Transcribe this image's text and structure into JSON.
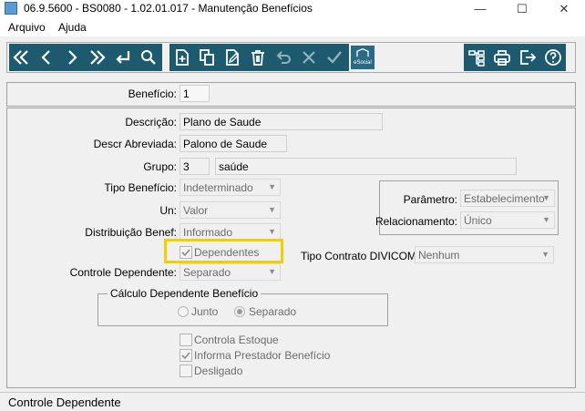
{
  "window": {
    "title": "06.9.5600 - BS0080 - 1.02.01.017 - Manutenção Benefícios",
    "minimize": "—",
    "maximize": "☐",
    "close": "✕"
  },
  "menu": [
    "Arquivo",
    "Ajuda"
  ],
  "toolbar": {
    "esocial_label": "eSocial",
    "accent": "#1e5a6e"
  },
  "form": {
    "beneficio_label": "Benefício:",
    "beneficio_value": "1",
    "descricao_label": "Descrição:",
    "descricao_value": "Plano de Saude",
    "descr_abrev_label": "Descr Abreviada:",
    "descr_abrev_value": "Palono de Saude",
    "grupo_label": "Grupo:",
    "grupo_code": "3",
    "grupo_name": "saúde",
    "tipo_beneficio_label": "Tipo Benefício:",
    "tipo_beneficio_value": "Indeterminado",
    "un_label": "Un:",
    "un_value": "Valor",
    "distribuicao_label": "Distribuição Benef:",
    "distribuicao_value": "Informado",
    "dependentes_label": "Dependentes",
    "controle_dependente_label": "Controle Dependente:",
    "controle_dependente_value": "Separado",
    "parametro_label": "Parâmetro:",
    "parametro_value": "Estabelecimento",
    "relacionamento_label": "Relacionamento:",
    "relacionamento_value": "Único",
    "tipo_contrato_label": "Tipo Contrato DIVICOM:",
    "tipo_contrato_value": "Nenhum",
    "calculo_group_label": "Cálculo Dependente Benefício",
    "radio_junto": "Junto",
    "radio_separado": "Separado",
    "controla_estoque": "Controla Estoque",
    "informa_prestador": "Informa Prestador Benefício",
    "desligado": "Desligado",
    "highlight_color": "#f0d000"
  },
  "status": {
    "text": "Controle Dependente"
  }
}
